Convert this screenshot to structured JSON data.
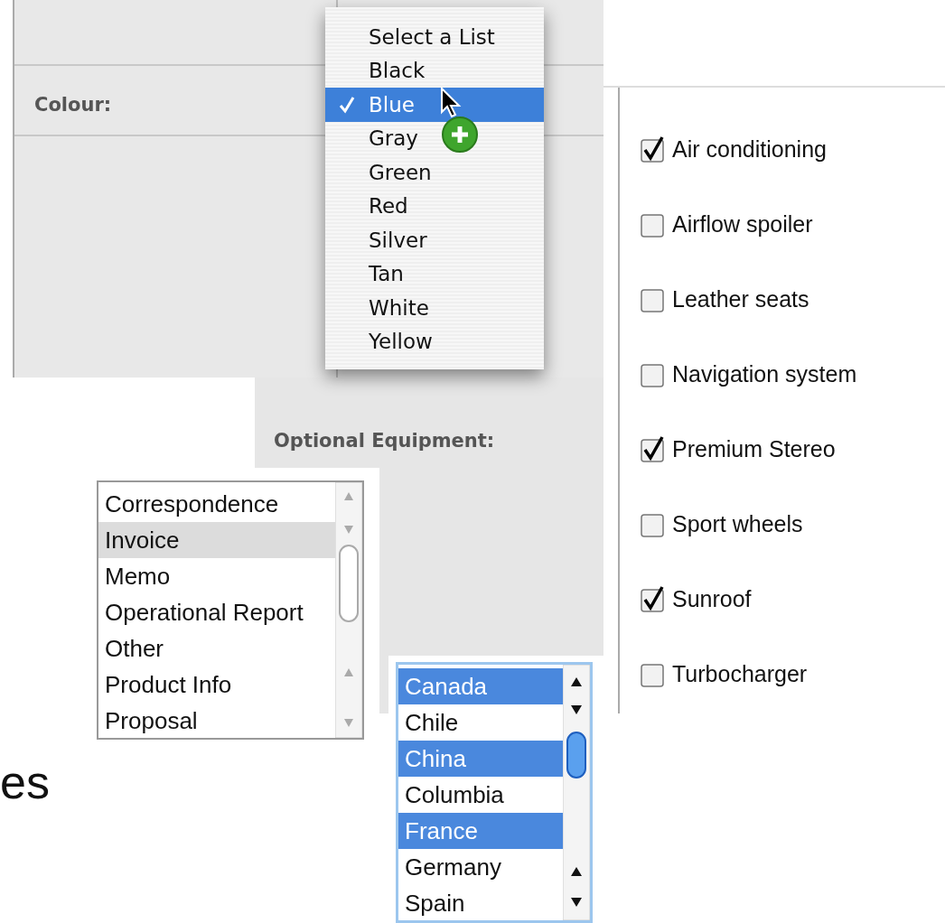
{
  "colour_form": {
    "label": "Colour:",
    "menu": {
      "items": [
        {
          "label": "Select a List",
          "selected": false
        },
        {
          "label": "Black",
          "selected": false
        },
        {
          "label": "Blue",
          "selected": true
        },
        {
          "label": "Gray",
          "selected": false
        },
        {
          "label": "Green",
          "selected": false
        },
        {
          "label": "Red",
          "selected": false
        },
        {
          "label": "Silver",
          "selected": false
        },
        {
          "label": "Tan",
          "selected": false
        },
        {
          "label": "White",
          "selected": false
        },
        {
          "label": "Yellow",
          "selected": false
        }
      ]
    }
  },
  "equipment": {
    "label": "Optional Equipment:",
    "options": [
      {
        "label": "Air conditioning",
        "checked": true
      },
      {
        "label": "Airflow spoiler",
        "checked": false
      },
      {
        "label": "Leather seats",
        "checked": false
      },
      {
        "label": "Navigation system",
        "checked": false
      },
      {
        "label": "Premium Stereo",
        "checked": true
      },
      {
        "label": "Sport wheels",
        "checked": false
      },
      {
        "label": "Sunroof",
        "checked": true
      },
      {
        "label": "Turbocharger",
        "checked": false
      }
    ]
  },
  "document_list": {
    "items": [
      {
        "label": "Correspondence",
        "selected": false
      },
      {
        "label": "Invoice",
        "selected": true
      },
      {
        "label": "Memo",
        "selected": false
      },
      {
        "label": "Operational Report",
        "selected": false
      },
      {
        "label": "Other",
        "selected": false
      },
      {
        "label": "Product Info",
        "selected": false
      },
      {
        "label": "Proposal",
        "selected": false
      }
    ]
  },
  "country_list": {
    "items": [
      {
        "label": "Canada",
        "selected": true
      },
      {
        "label": "Chile",
        "selected": false
      },
      {
        "label": "China",
        "selected": true
      },
      {
        "label": "Columbia",
        "selected": false
      },
      {
        "label": "France",
        "selected": true
      },
      {
        "label": "Germany",
        "selected": false
      },
      {
        "label": "Spain",
        "selected": false
      }
    ]
  },
  "cut_text": "es"
}
